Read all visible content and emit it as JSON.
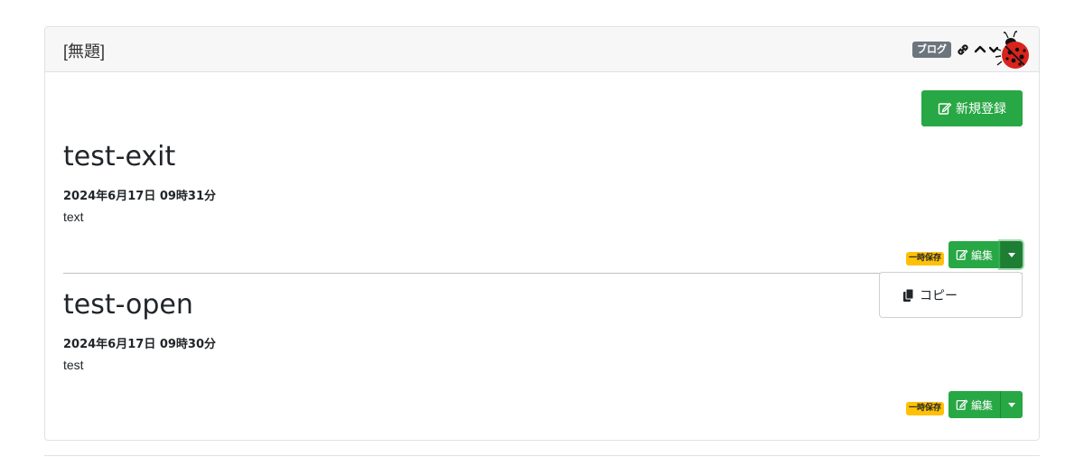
{
  "frame": {
    "title": "[無題]",
    "plugin_badge": "ブログ",
    "new_button_label": "新規登録"
  },
  "posts": [
    {
      "title": "test-exit",
      "date": "2024年6月17日 09時31分",
      "body": "text",
      "temp_badge": "一時保存",
      "edit_label": "編集"
    },
    {
      "title": "test-open",
      "date": "2024年6月17日 09時30分",
      "body": "test",
      "temp_badge": "一時保存",
      "edit_label": "編集"
    }
  ],
  "dropdown": {
    "items": [
      {
        "label": "コピー",
        "icon": "copy-icon"
      }
    ]
  },
  "icons": {
    "link": "link-icon",
    "collapse": "chevron-up-icon",
    "expand": "chevron-down-icon",
    "mascot": "ladybug-icon",
    "edit": "edit-icon"
  },
  "colors": {
    "success": "#28a745",
    "warning": "#ffc107",
    "secondary": "#6c757d"
  }
}
